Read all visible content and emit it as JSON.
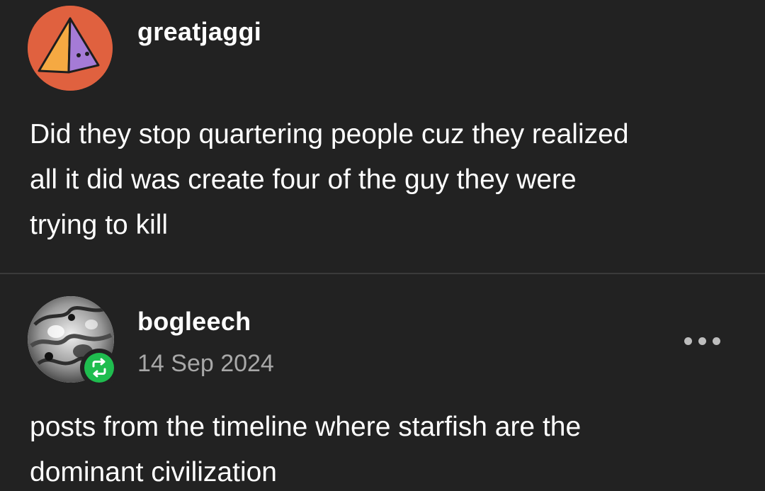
{
  "posts": [
    {
      "author": "greatjaggi",
      "avatar_icon": "pyramid-avatar-icon",
      "lines": [
        "Did they stop quartering people cuz they realized",
        "all it did was create four of the guy they were",
        "trying to kill"
      ]
    },
    {
      "author": "bogleech",
      "date": "14 Sep 2024",
      "avatar_icon": "grayscale-creature-avatar-icon",
      "badge_icon": "reblog-icon",
      "more_icon": "more-options-icon",
      "lines": [
        "posts from the timeline where starfish are the",
        "dominant civilization"
      ]
    }
  ],
  "colors": {
    "background": "#222222",
    "text": "#ffffff",
    "muted": "#a8a8a8",
    "avatar_orange": "#e0613f",
    "pyramid_left": "#f5a942",
    "pyramid_right": "#a57bd6",
    "reblog_green": "#1fbd4f"
  }
}
